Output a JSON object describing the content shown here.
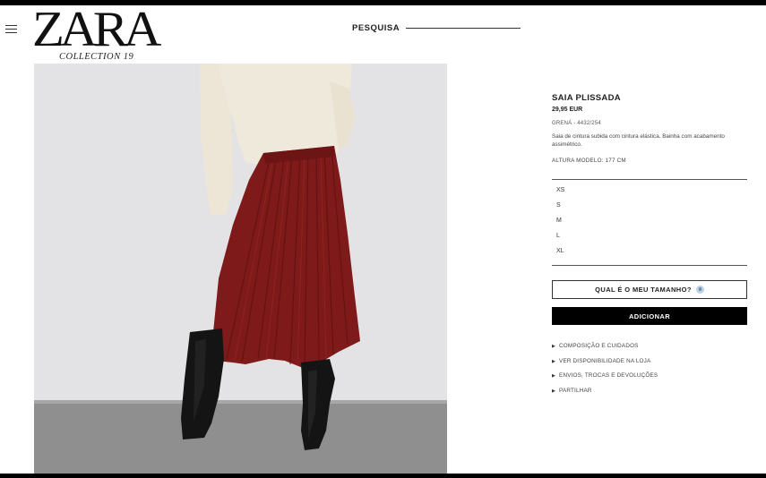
{
  "header": {
    "logo": "ZARA",
    "logo_subtitle": "COLLECTION 19",
    "search_label": "PESQUISA"
  },
  "product": {
    "title": "SAIA PLISSADA",
    "price": "29,95 EUR",
    "color_ref": "GRENÁ - 4432/254",
    "description": "Saia de cintura subida com cintura elástica. Bainha com acabamento assimétrico.",
    "model_height": "ALTURA MODELO: 177 CM",
    "image_alt": "Pleated burgundy skirt worn with cream knit sweater and black leather boots"
  },
  "sizes": [
    "XS",
    "S",
    "M",
    "L",
    "XL"
  ],
  "actions": {
    "size_guide_label": "QUAL É O MEU TAMANHO?",
    "add_label": "ADICIONAR"
  },
  "links": [
    "COMPOSIÇÃO E CUIDADOS",
    "VER DISPONIBILIDADE NA LOJA",
    "ENVIOS, TROCAS E DEVOLUÇÕES",
    "PARTILHAR"
  ],
  "colors": {
    "skirt": "#7e1a1a",
    "sweater": "#efe9dc",
    "background_wall": "#e3e3e5",
    "floor": "#8c8c8c",
    "boots": "#141414"
  },
  "icons": {
    "menu": "hamburger-menu-icon",
    "link_bullet": "triangle-right-icon",
    "size_guide": "person-silhouette-icon"
  }
}
